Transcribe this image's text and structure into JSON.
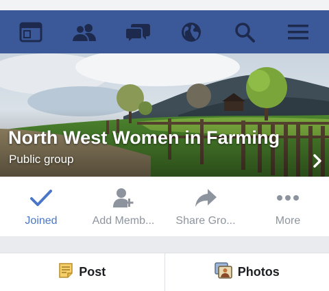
{
  "colors": {
    "nav_bg": "#3b5998",
    "accent": "#4a76c8",
    "muted": "#8d949e"
  },
  "nav": {
    "items": [
      {
        "icon": "news-feed-icon"
      },
      {
        "icon": "friends-icon"
      },
      {
        "icon": "messages-icon"
      },
      {
        "icon": "globe-icon"
      },
      {
        "icon": "search-icon"
      },
      {
        "icon": "menu-icon"
      }
    ]
  },
  "group": {
    "title": "North West Women in Farming",
    "privacy": "Public group"
  },
  "actions": [
    {
      "label": "Joined",
      "icon": "checkmark-icon",
      "active": true
    },
    {
      "label": "Add Memb...",
      "icon": "add-member-icon"
    },
    {
      "label": "Share Gro...",
      "icon": "share-icon"
    },
    {
      "label": "More",
      "icon": "more-icon"
    }
  ],
  "composer": {
    "post_label": "Post",
    "photos_label": "Photos"
  }
}
